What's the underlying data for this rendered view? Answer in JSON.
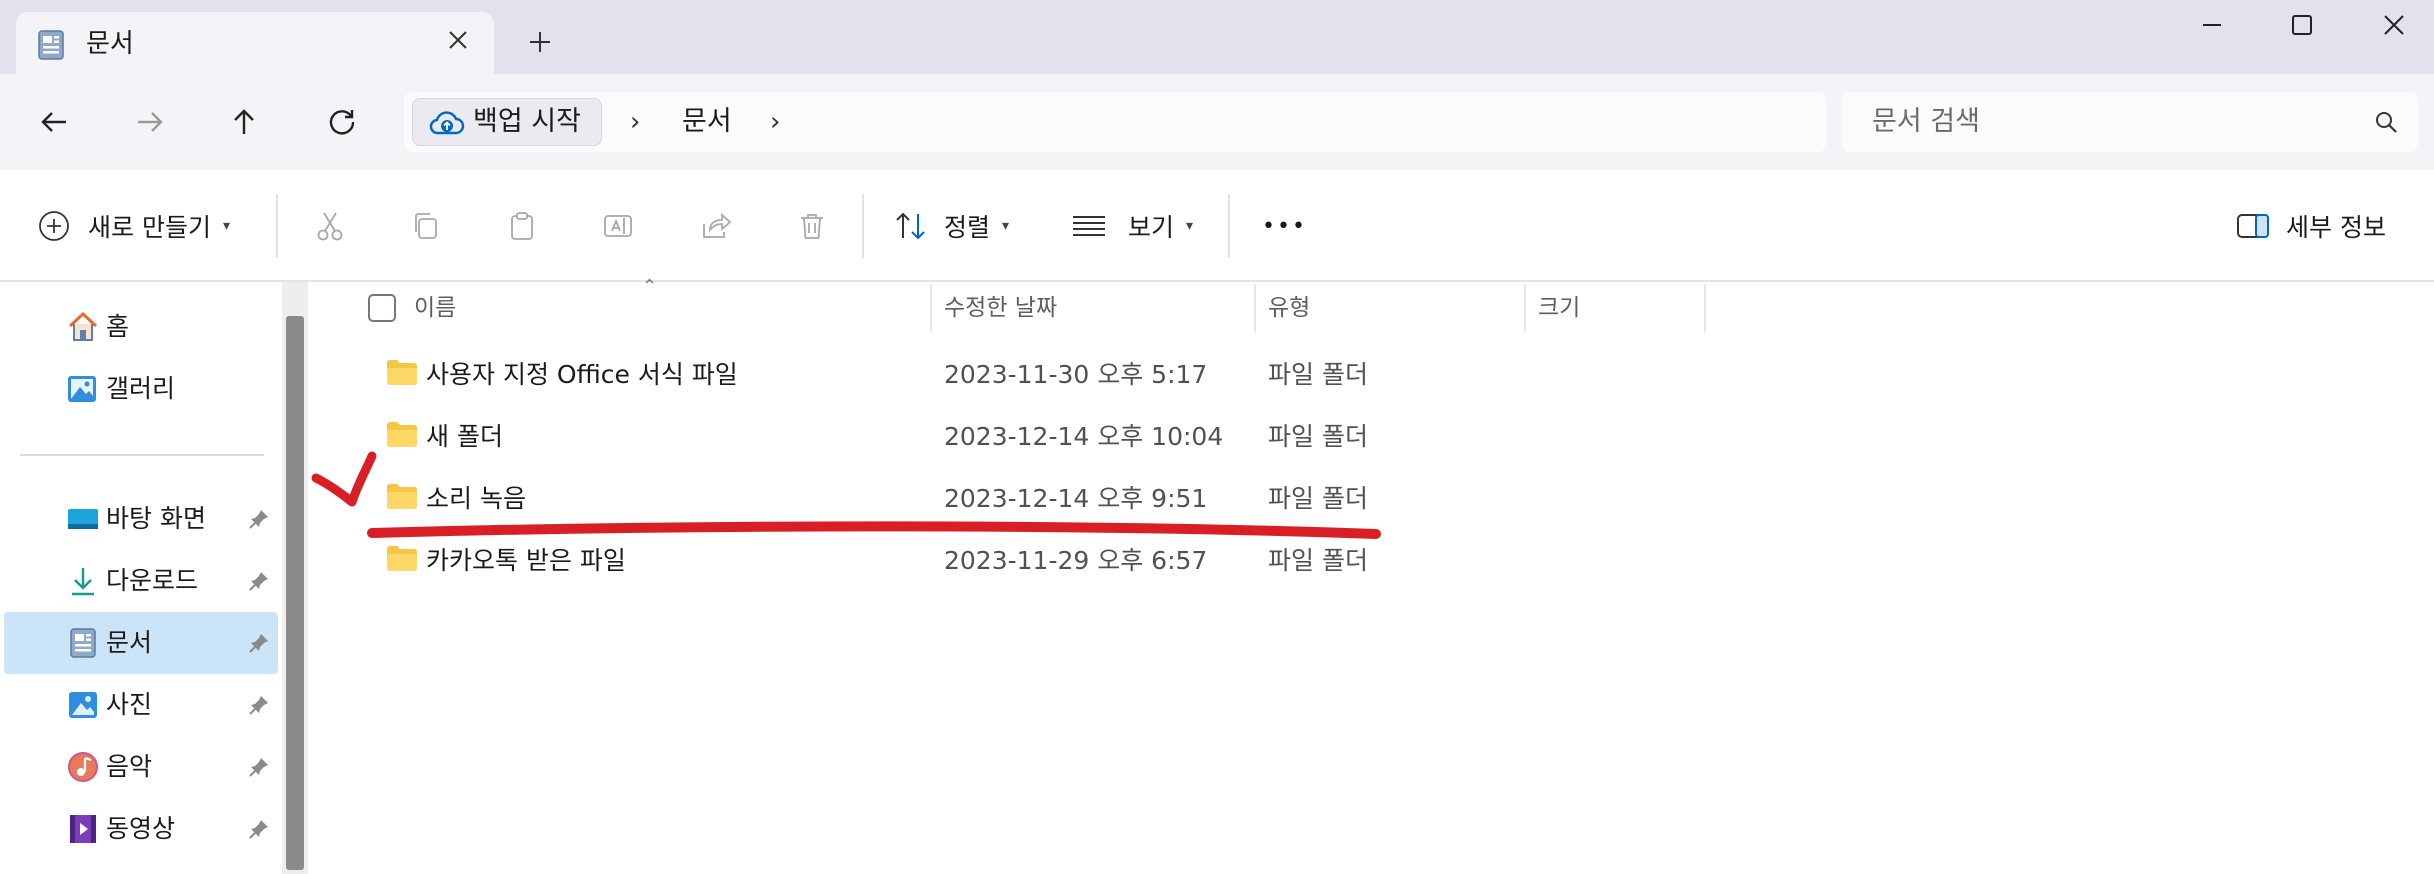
{
  "tab": {
    "title": "문서",
    "close_icon": "close-icon",
    "new_tab_icon": "plus-icon"
  },
  "window": {
    "minimize_icon": "minimize-icon",
    "maximize_icon": "maximize-icon",
    "close_icon": "close-icon"
  },
  "nav": {
    "breadcrumb": [
      "백업 시작",
      "문서"
    ],
    "search_placeholder": "문서 검색"
  },
  "toolbar": {
    "new_label": "새로 만들기",
    "sort_label": "정렬",
    "view_label": "보기",
    "more_label": "•••",
    "details_label": "세부 정보"
  },
  "sidebar": {
    "top": [
      {
        "label": "홈",
        "icon": "home-icon"
      },
      {
        "label": "갤러리",
        "icon": "gallery-icon"
      }
    ],
    "pinned": [
      {
        "label": "바탕 화면",
        "icon": "desktop-icon"
      },
      {
        "label": "다운로드",
        "icon": "download-icon"
      },
      {
        "label": "문서",
        "icon": "document-icon",
        "selected": true
      },
      {
        "label": "사진",
        "icon": "pictures-icon"
      },
      {
        "label": "음악",
        "icon": "music-icon"
      },
      {
        "label": "동영상",
        "icon": "video-icon"
      }
    ]
  },
  "columns": {
    "name": "이름",
    "date": "수정한 날짜",
    "type": "유형",
    "size": "크기"
  },
  "files": [
    {
      "name": "사용자 지정 Office 서식 파일",
      "date": "2023-11-30 오후 5:17",
      "type": "파일 폴더"
    },
    {
      "name": "새 폴더",
      "date": "2023-12-14 오후 10:04",
      "type": "파일 폴더"
    },
    {
      "name": "소리 녹음",
      "date": "2023-12-14 오후 9:51",
      "type": "파일 폴더"
    },
    {
      "name": "카카오톡 받은 파일",
      "date": "2023-11-29 오후 6:57",
      "type": "파일 폴더"
    }
  ],
  "colors": {
    "accent": "#0067c0",
    "selected": "#cce4f7",
    "folder": "#f5c545",
    "annotation": "#d81f26"
  }
}
